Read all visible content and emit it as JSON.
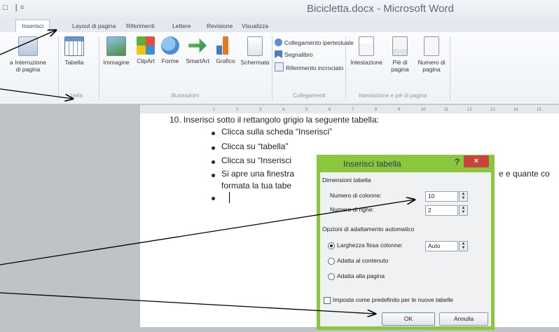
{
  "window": {
    "qat": "□ |=",
    "title": "Bicicletta.docx - Microsoft Word"
  },
  "tabs": [
    "Inserisci",
    "Layout di pagina",
    "Riferimenti",
    "Lettere",
    "Revisione",
    "Visualizza"
  ],
  "ribbon": {
    "page_break": "a Interruzione\ndi pagina",
    "table": "Tabella",
    "image": "Immagine",
    "clipart": "ClipArt",
    "shapes": "Forme",
    "smartart": "SmartArt",
    "chart": "Grafico",
    "screenshot": "Schermata",
    "hyperlink": "Collegamento ipertestuale",
    "bookmark": "Segnalibro",
    "crossref": "Riferimento incrociato",
    "header": "Intestazione",
    "footer": "Piè di\npagina",
    "pagenum": "Numero di\npagina",
    "groups": {
      "tables": "bella",
      "illustrations": "Illustrazioni",
      "links": "Collegamenti",
      "header_footer": "Intestazione e piè di pagina"
    }
  },
  "ruler_ticks": [
    "1",
    "2",
    "3",
    "4",
    "5",
    "6",
    "7",
    "8",
    "9",
    "10",
    "11",
    "12",
    "13",
    "14",
    "15"
  ],
  "document": {
    "line1": "10. Inserisci sotto il rettangolo grigio la seguente tabella:",
    "bullets": [
      "Clicca sulla scheda “Inserisci”",
      "Clicca su “tabella”",
      "Clicca su “Inserisci",
      "Si apre una finestra"
    ],
    "bullet4_tail": "e e quante co",
    "line_cont": "formata la tua tabe"
  },
  "dialog": {
    "title": "Inserisci tabella",
    "help": "?",
    "close": "×",
    "section_size": "Dimensioni tabella",
    "cols_label": "Numero di colonne:",
    "cols_value": "10",
    "rows_label": "Numero di righe:",
    "rows_value": "2",
    "section_fit": "Opzioni di adattamento automatico",
    "fixed_label": "Larghezza fissa colonne:",
    "fixed_value": "Auto",
    "fit_content": "Adatta al contenuto",
    "fit_page": "Adatta alla pagina",
    "default_chk": "Imposta come predefinito per le nuove tabelle",
    "ok": "OK",
    "cancel": "Annulla"
  },
  "colors": {
    "dialog_frame": "#8cc63e",
    "close": "#c9453b",
    "gray": "#bfc3c8"
  }
}
